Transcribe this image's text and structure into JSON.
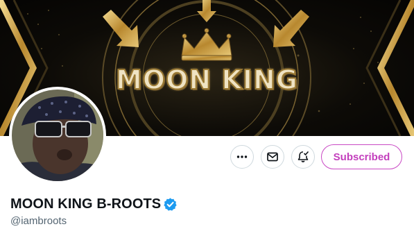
{
  "banner": {
    "title": "MOON KING"
  },
  "profile": {
    "display_name": "MOON KING B-ROOTS",
    "handle": "@iambroots",
    "verified": true
  },
  "actions": {
    "more_icon": "more-horizontal-icon",
    "message_icon": "envelope-icon",
    "notify_icon": "bell-check-icon",
    "subscribed_label": "Subscribed"
  },
  "colors": {
    "subscribed_accent": "#c33fbd",
    "verified_badge": "#1d9bf0",
    "handle_text": "#536471",
    "banner_gold": "#c9a24a"
  }
}
